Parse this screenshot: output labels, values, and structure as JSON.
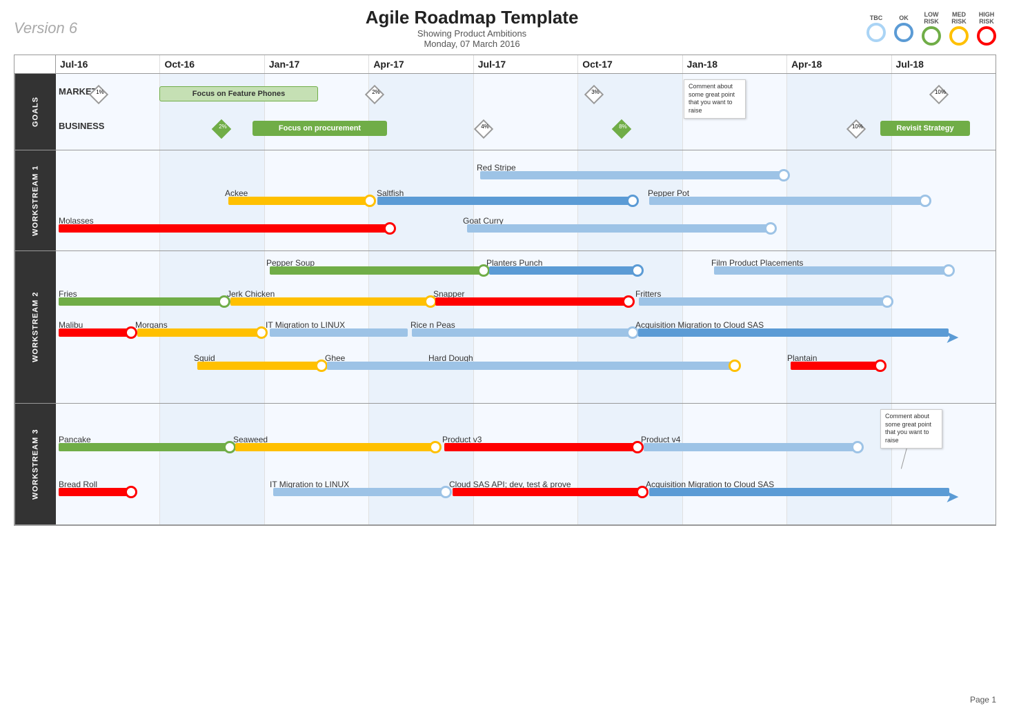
{
  "header": {
    "version": "Version 6",
    "title": "Agile Roadmap Template",
    "subtitle": "Showing Product Ambitions",
    "date": "Monday, 07 March 2016"
  },
  "legend": {
    "items": [
      {
        "label": "TBC",
        "class": "tbc"
      },
      {
        "label": "OK",
        "class": "ok"
      },
      {
        "label": "LOW\nRISK",
        "class": "low"
      },
      {
        "label": "MED\nRISK",
        "class": "med"
      },
      {
        "label": "HIGH\nRISK",
        "class": "high"
      }
    ]
  },
  "timeline": {
    "columns": [
      "Jul-16",
      "Oct-16",
      "Jan-17",
      "Apr-17",
      "Jul-17",
      "Oct-17",
      "Jan-18",
      "Apr-18",
      "Jul-18"
    ]
  },
  "page": "Page 1"
}
